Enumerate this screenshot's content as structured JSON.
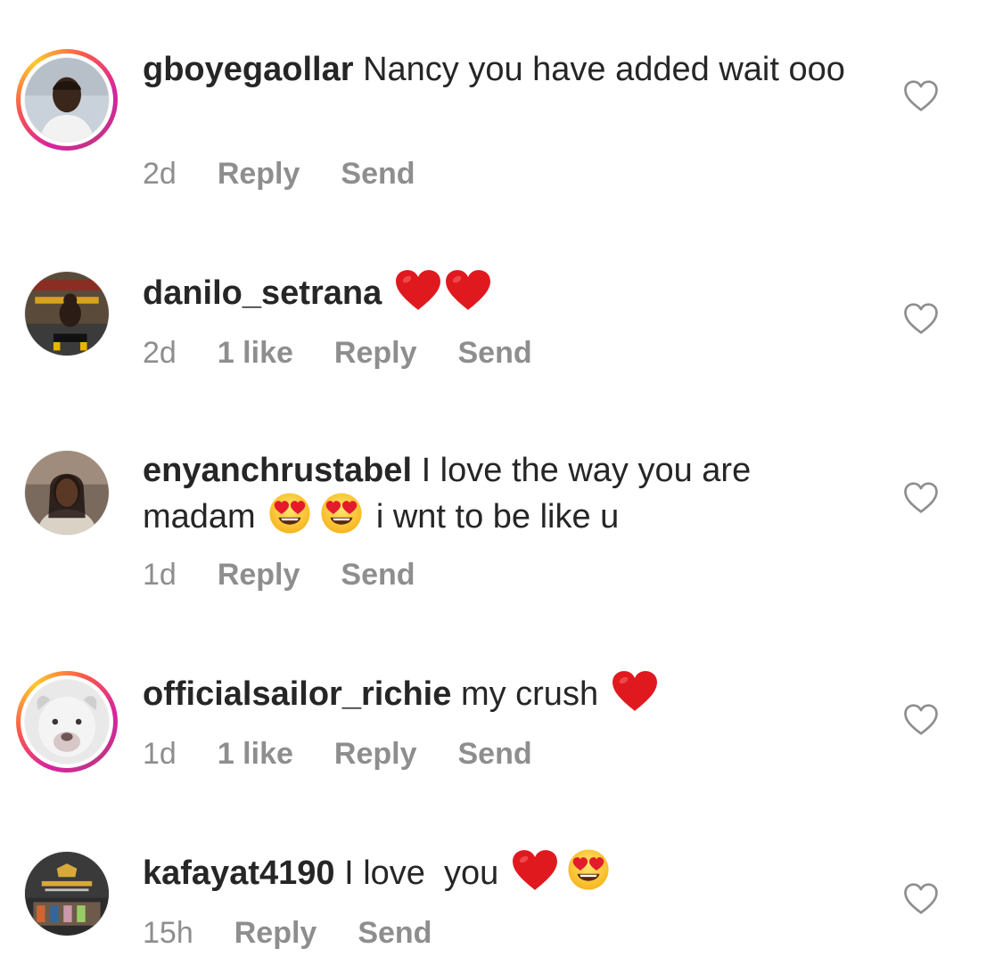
{
  "colors": {
    "text": "#262626",
    "meta": "#8e8e8e",
    "heart_emoji": "#e0191f",
    "story_ring": "#d6249f"
  },
  "comments": [
    {
      "username": "gboyegaollar",
      "text_parts": [
        "Nancy you have added wait ooo"
      ],
      "emojis": [],
      "time": "2d",
      "likes": "",
      "reply_label": "Reply",
      "send_label": "Send",
      "has_story_ring": true,
      "like_icon": "heart-outline-icon"
    },
    {
      "username": "danilo_setrana",
      "text_parts": [],
      "emojis": [
        "red-heart-emoji",
        "red-heart-emoji"
      ],
      "time": "2d",
      "likes": "1 like",
      "reply_label": "Reply",
      "send_label": "Send",
      "has_story_ring": false,
      "like_icon": "heart-outline-icon"
    },
    {
      "username": "enyanchrustabel",
      "text_parts": [
        "I love the way you are madam",
        "i wnt to be like u"
      ],
      "emojis": [
        "heart-eyes-emoji",
        "heart-eyes-emoji"
      ],
      "time": "1d",
      "likes": "",
      "reply_label": "Reply",
      "send_label": "Send",
      "has_story_ring": false,
      "like_icon": "heart-outline-icon"
    },
    {
      "username": "officialsailor_richie",
      "text_parts": [
        "my crush"
      ],
      "emojis": [
        "red-heart-emoji"
      ],
      "time": "1d",
      "likes": "1 like",
      "reply_label": "Reply",
      "send_label": "Send",
      "has_story_ring": true,
      "like_icon": "heart-outline-icon"
    },
    {
      "username": "kafayat4190",
      "text_parts": [
        "I love  you"
      ],
      "emojis": [
        "red-heart-emoji",
        "heart-eyes-emoji"
      ],
      "time": "15h",
      "likes": "",
      "reply_label": "Reply",
      "send_label": "Send",
      "has_story_ring": false,
      "like_icon": "heart-outline-icon"
    }
  ]
}
